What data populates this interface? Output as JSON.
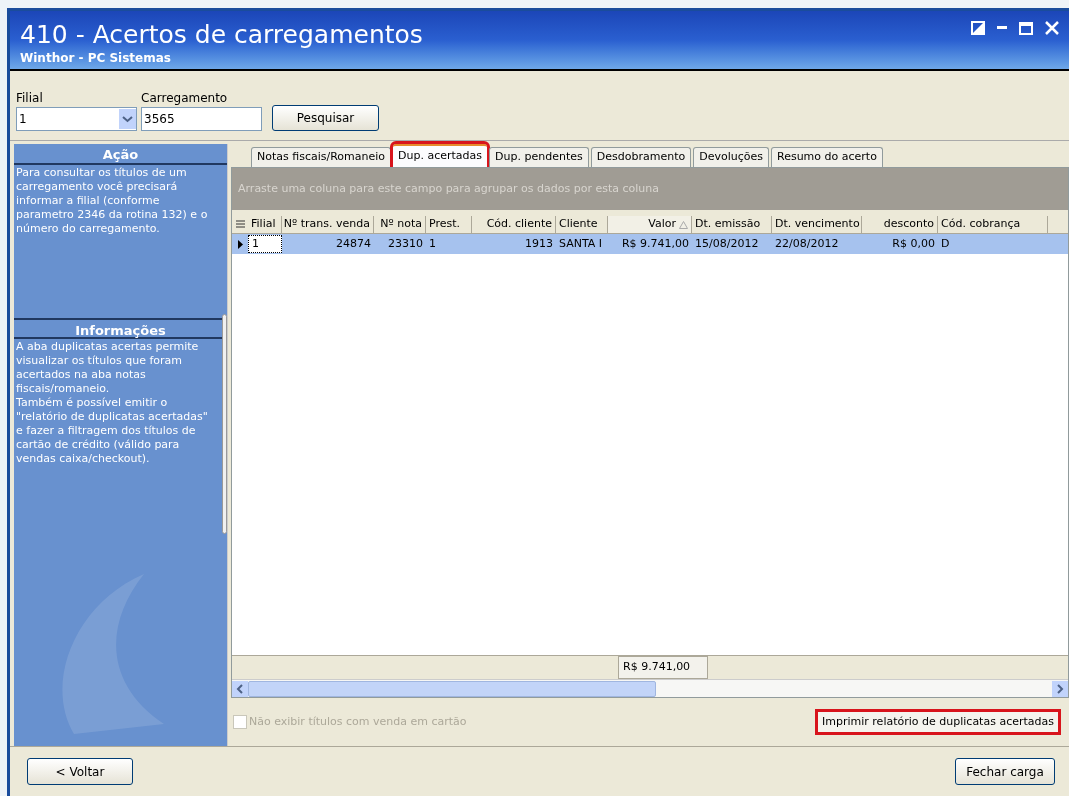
{
  "window": {
    "title": "410 - Acertos de carregamentos",
    "subtitle": "Winthor - PC Sistemas"
  },
  "filters": {
    "filial_label": "Filial",
    "filial_value": "1",
    "carregamento_label": "Carregamento",
    "carregamento_value": "3565",
    "search_button": "Pesquisar"
  },
  "sidebar": [
    {
      "heading": "Ação",
      "text": "Para consultar os títulos de um carregamento você precisará informar a filial (conforme parametro 2346 da rotina 132) e o número do carregamento."
    },
    {
      "heading": "Informações",
      "text": "A aba duplicatas acertas permite visualizar os títulos que foram acertados na aba notas fiscais/romaneio.\nTambém é possível emitir o \"relatório de duplicatas acertadas\" e fazer a filtragem dos títulos de cartão de crédito (válido para vendas caixa/checkout)."
    }
  ],
  "tabs": [
    {
      "label": "Notas fiscais/Romaneio",
      "selected": false,
      "highlighted": false
    },
    {
      "label": "Dup. acertadas",
      "selected": true,
      "highlighted": true
    },
    {
      "label": "Dup. pendentes",
      "selected": false,
      "highlighted": false
    },
    {
      "label": "Desdobramento",
      "selected": false,
      "highlighted": false
    },
    {
      "label": "Devoluções",
      "selected": false,
      "highlighted": false
    },
    {
      "label": "Resumo do acerto",
      "selected": false,
      "highlighted": false
    }
  ],
  "group_hint": "Arraste uma coluna para este campo para agrupar os dados por esta coluna",
  "table": {
    "columns": [
      {
        "label": "Filial",
        "sorted": false
      },
      {
        "label": "Nº trans. venda",
        "sorted": false
      },
      {
        "label": "Nº nota",
        "sorted": false
      },
      {
        "label": "Prest.",
        "sorted": false
      },
      {
        "label": "Cód. cliente",
        "sorted": false
      },
      {
        "label": "Cliente",
        "sorted": false
      },
      {
        "label": "Valor",
        "sorted": true
      },
      {
        "label": "Dt. emissão",
        "sorted": false
      },
      {
        "label": "Dt. vencimento",
        "sorted": false
      },
      {
        "label": "desconto",
        "sorted": false
      },
      {
        "label": "Cód. cobrança",
        "sorted": false
      }
    ],
    "rows": [
      {
        "selected": true,
        "cells": [
          "1",
          "24874",
          "23310",
          "1",
          "1913",
          "SANTA I",
          "R$ 9.741,00",
          "15/08/2012",
          "22/08/2012",
          "R$ 0,00",
          "D"
        ]
      }
    ],
    "footer_total": "R$ 9.741,00"
  },
  "hide_card_checkbox": {
    "label": "Não exibir títulos com venda em cartão",
    "checked": false,
    "disabled": true
  },
  "print_button": {
    "label": "Imprimir relatório de duplicatas acertadas",
    "highlighted": true
  },
  "buttons": {
    "back": "< Voltar",
    "close": "Fechar carga"
  }
}
